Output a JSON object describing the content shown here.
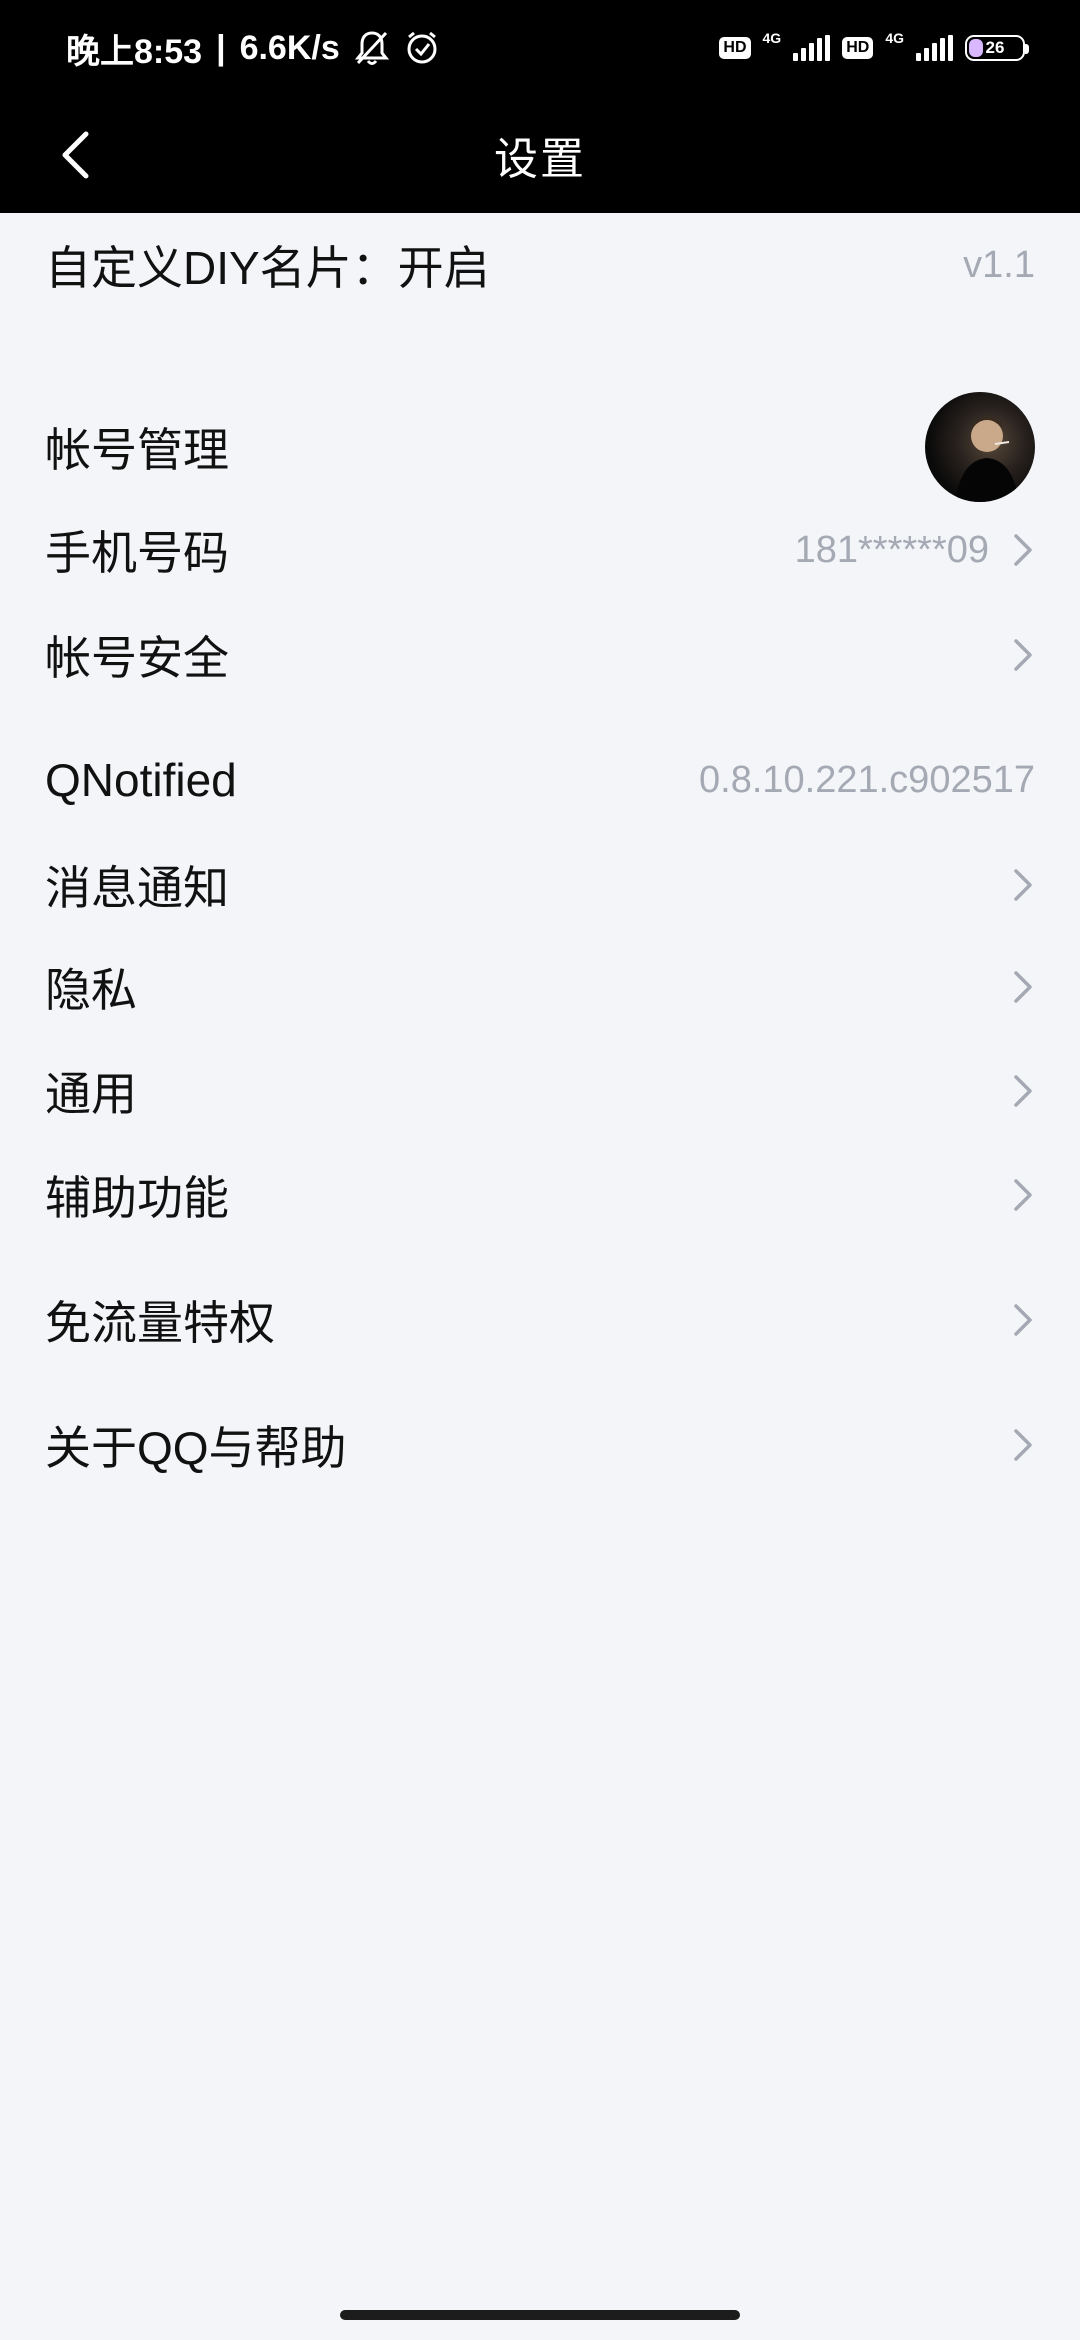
{
  "status_bar": {
    "time": "晚上8:53",
    "speed": "6.6K/s",
    "hd_badge": "HD",
    "network_label": "4G",
    "battery": "26",
    "battery_level": 0.26
  },
  "header": {
    "title": "设置",
    "back_icon": "chevron-left-icon"
  },
  "rows": [
    {
      "label": "自定义DIY名片：开启",
      "value": "v1.1",
      "chevron": false
    },
    {
      "label": "帐号管理",
      "value": "",
      "avatar": true,
      "chevron": false
    },
    {
      "label": "手机号码",
      "value": "181******09",
      "chevron": true
    },
    {
      "label": "帐号安全",
      "value": "",
      "chevron": true
    },
    {
      "label": "QNotified",
      "value": "0.8.10.221.c902517",
      "chevron": false
    },
    {
      "label": "消息通知",
      "value": "",
      "chevron": true
    },
    {
      "label": "隐私",
      "value": "",
      "chevron": true
    },
    {
      "label": "通用",
      "value": "",
      "chevron": true
    },
    {
      "label": "辅助功能",
      "value": "",
      "chevron": true
    },
    {
      "label": "免流量特权",
      "value": "",
      "chevron": true
    },
    {
      "label": "关于QQ与帮助",
      "value": "",
      "chevron": true
    }
  ],
  "colors": {
    "header_bg": "#000000",
    "page_bg": "#f4f5f9",
    "secondary_text": "#a4a9b3"
  }
}
